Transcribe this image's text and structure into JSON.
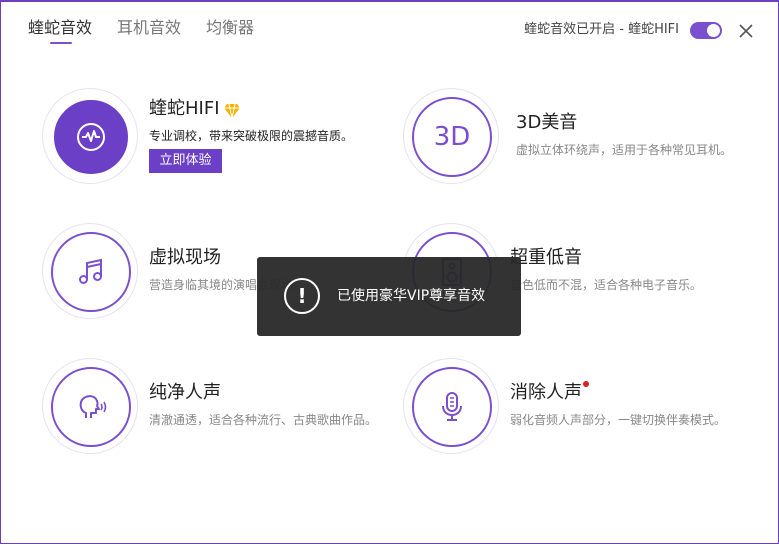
{
  "tabs": [
    {
      "label": "蝰蛇音效",
      "active": true
    },
    {
      "label": "耳机音效",
      "active": false
    },
    {
      "label": "均衡器",
      "active": false
    }
  ],
  "header": {
    "status": "蝰蛇音效已开启 - 蝰蛇HIFI",
    "toggle_on": true
  },
  "effects": [
    {
      "title": "蝰蛇HIFI",
      "desc": "专业调校，带来突破极限的震撼音质。",
      "button": "立即体验",
      "icon": "waveform-icon",
      "badge": "diamond-icon"
    },
    {
      "title": "3D美音",
      "desc": "虚拟立体环绕声，适用于各种常见耳机。",
      "icon_text": "3D"
    },
    {
      "title": "虚拟现场",
      "desc": "营造身临其境的演唱会现场",
      "icon": "music-note-icon"
    },
    {
      "title": "超重低音",
      "desc": "音色低而不混，适合各种电子音乐。",
      "icon": "speaker-icon"
    },
    {
      "title": "纯净人声",
      "desc": "清澈通透，适合各种流行、古典歌曲作品。",
      "icon": "voice-icon"
    },
    {
      "title": "消除人声",
      "desc": "弱化音频人声部分，一键切换伴奏模式。",
      "icon": "microphone-icon",
      "new_dot": true
    }
  ],
  "toast": {
    "message": "已使用豪华VIP尊享音效",
    "icon": "exclamation-icon"
  },
  "colors": {
    "accent": "#6b3fc6",
    "dot": "#e02020"
  }
}
